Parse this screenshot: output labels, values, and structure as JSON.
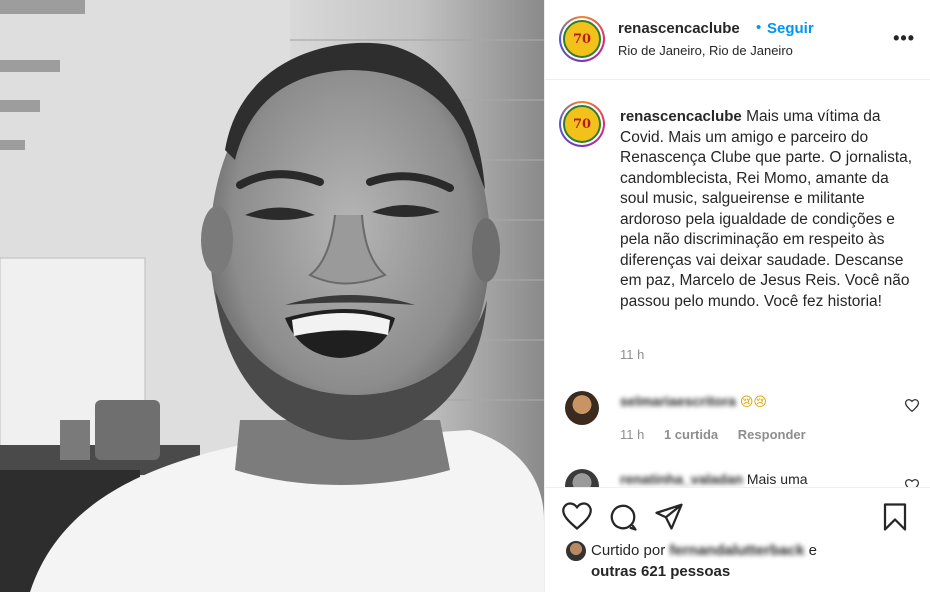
{
  "post": {
    "username": "renascencaclube",
    "follow_label": "Seguir",
    "location": "Rio de Janeiro, Rio de Janeiro",
    "more_label": "•••",
    "avatar_text": "70",
    "caption": "Mais uma vítima da Covid. Mais um amigo e parceiro do Renascença Clube que parte. O jornalista, candomblecista, Rei Momo, amante da soul music, salgueirense e militante ardoroso pela igualdade de condições e pela não discriminação em respeito às diferenças vai deixar saudade. Descanse em paz, Marcelo de Jesus Reis. Você não passou pelo mundo. Você fez historia!",
    "time": "11 h"
  },
  "comments": [
    {
      "username": "selmariaescritora",
      "text": "😢😢",
      "time": "11 h",
      "likes": "1 curtida",
      "reply_label": "Responder"
    },
    {
      "username": "renatinha_valadan",
      "text": "Mais uma"
    }
  ],
  "likes": {
    "prefix": "Curtido por",
    "liker": "fernandalutterback",
    "suffix": "e",
    "others": "outras 621 pessoas"
  },
  "colors": {
    "accent": "#0095f6",
    "text": "#262626",
    "muted": "#8e8e8e"
  },
  "icons": [
    "heart-icon",
    "comment-icon",
    "share-icon",
    "save-icon",
    "more-icon"
  ]
}
